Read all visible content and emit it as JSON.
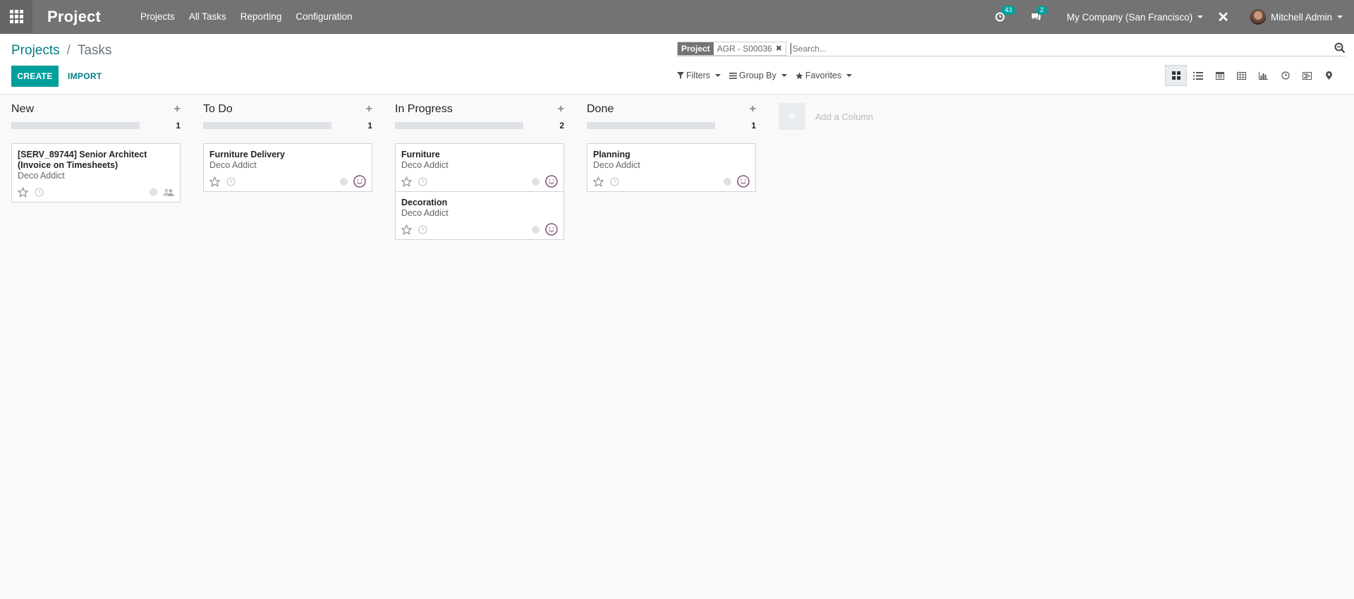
{
  "navbar": {
    "app_title": "Project",
    "menu": [
      "Projects",
      "All Tasks",
      "Reporting",
      "Configuration"
    ],
    "activity_count": "43",
    "messages_count": "2",
    "company": "My Company (San Francisco)",
    "user": "Mitchell Admin"
  },
  "breadcrumb": {
    "parent": "Projects",
    "separator": "/",
    "current": "Tasks"
  },
  "buttons": {
    "create": "CREATE",
    "import": "IMPORT"
  },
  "search": {
    "facet_label": "Project",
    "facet_value": "AGR - S00036",
    "placeholder": "Search..."
  },
  "filters": {
    "filters_label": "Filters",
    "groupby_label": "Group By",
    "favorites_label": "Favorites"
  },
  "views": [
    "kanban",
    "list",
    "calendar",
    "pivot",
    "graph",
    "activity",
    "gantt",
    "map"
  ],
  "active_view": "kanban",
  "columns": [
    {
      "title": "New",
      "count": "1",
      "cards": [
        {
          "title": "[SERV_89744] Senior Architect (Invoice on Timesheets)",
          "partner": "Deco Addict",
          "right_icon": "people-icon"
        }
      ]
    },
    {
      "title": "To Do",
      "count": "1",
      "cards": [
        {
          "title": "Furniture Delivery",
          "partner": "Deco Addict",
          "right_icon": "avatar-icon"
        }
      ]
    },
    {
      "title": "In Progress",
      "count": "2",
      "cards": [
        {
          "title": "Furniture",
          "partner": "Deco Addict",
          "right_icon": "avatar-icon"
        },
        {
          "title": "Decoration",
          "partner": "Deco Addict",
          "right_icon": "avatar-icon"
        }
      ]
    },
    {
      "title": "Done",
      "count": "1",
      "cards": [
        {
          "title": "Planning",
          "partner": "Deco Addict",
          "right_icon": "avatar-icon"
        }
      ]
    }
  ],
  "add_column_label": "Add a Column",
  "colors": {
    "navbar": "#737373",
    "accent": "#00a09d",
    "link": "#017e84"
  }
}
